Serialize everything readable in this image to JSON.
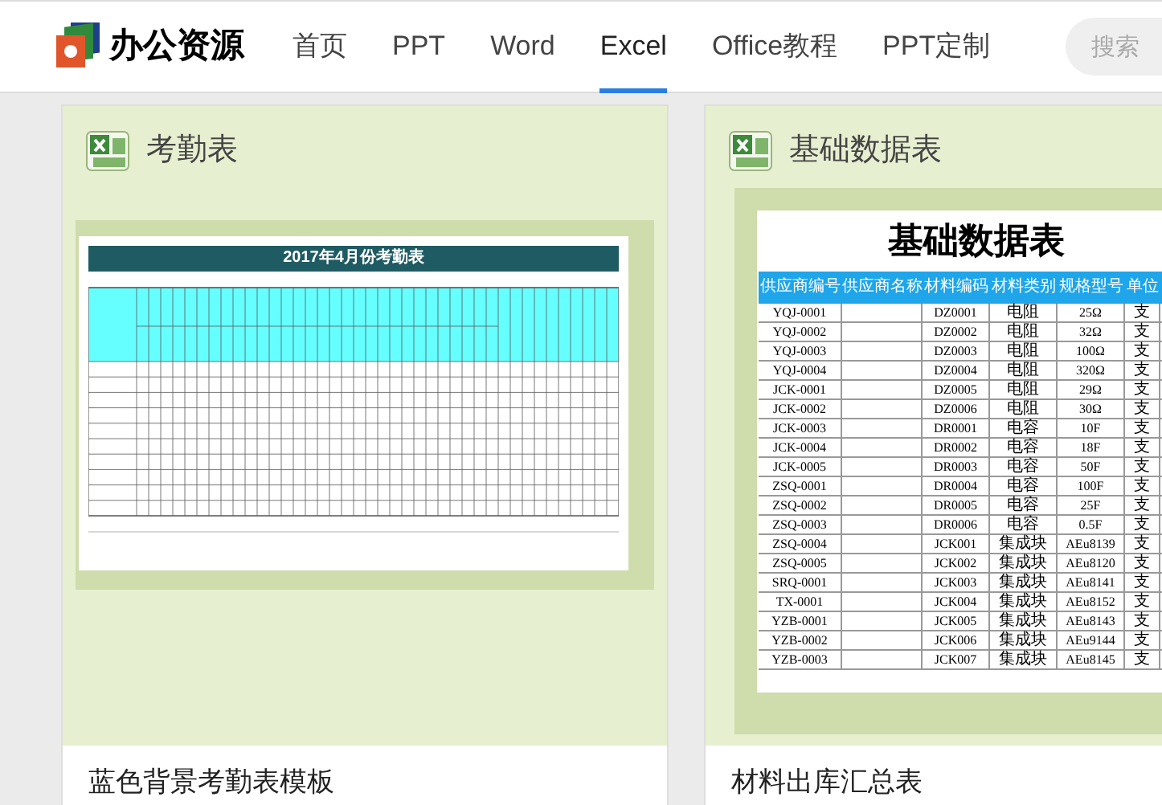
{
  "header": {
    "logo": "办公资源",
    "nav": [
      {
        "label": "首页",
        "selected": false
      },
      {
        "label": "PPT",
        "selected": false
      },
      {
        "label": "Word",
        "selected": false
      },
      {
        "label": "Excel",
        "selected": true
      },
      {
        "label": "Office教程",
        "selected": false
      },
      {
        "label": "PPT定制",
        "selected": false
      }
    ],
    "search": {
      "placeholder": "搜索"
    }
  },
  "cards": [
    {
      "kind": "attendance",
      "title": "考勤表",
      "sheet_title": "2017年4月份考勤表",
      "caption": "蓝色背景考勤表模板"
    },
    {
      "kind": "table",
      "title": "基础数据表",
      "sheet_title": "基础数据表",
      "columns": [
        "供应商编号",
        "供应商名称",
        "材料编码",
        "材料类别",
        "规格型号",
        "单位"
      ],
      "rows": [
        {
          "supplier_code": "YQJ-0001",
          "material_code": "DZ0001",
          "category": "电阻",
          "spec": "25Ω",
          "unit": "支"
        },
        {
          "supplier_code": "YQJ-0002",
          "material_code": "DZ0002",
          "category": "电阻",
          "spec": "32Ω",
          "unit": "支"
        },
        {
          "supplier_code": "YQJ-0003",
          "material_code": "DZ0003",
          "category": "电阻",
          "spec": "100Ω",
          "unit": "支"
        },
        {
          "supplier_code": "YQJ-0004",
          "material_code": "DZ0004",
          "category": "电阻",
          "spec": "320Ω",
          "unit": "支"
        },
        {
          "supplier_code": "JCK-0001",
          "material_code": "DZ0005",
          "category": "电阻",
          "spec": "29Ω",
          "unit": "支"
        },
        {
          "supplier_code": "JCK-0002",
          "material_code": "DZ0006",
          "category": "电阻",
          "spec": "30Ω",
          "unit": "支"
        },
        {
          "supplier_code": "JCK-0003",
          "material_code": "DR0001",
          "category": "电容",
          "spec": "10F",
          "unit": "支"
        },
        {
          "supplier_code": "JCK-0004",
          "material_code": "DR0002",
          "category": "电容",
          "spec": "18F",
          "unit": "支"
        },
        {
          "supplier_code": "JCK-0005",
          "material_code": "DR0003",
          "category": "电容",
          "spec": "50F",
          "unit": "支"
        },
        {
          "supplier_code": "ZSQ-0001",
          "material_code": "DR0004",
          "category": "电容",
          "spec": "100F",
          "unit": "支"
        },
        {
          "supplier_code": "ZSQ-0002",
          "material_code": "DR0005",
          "category": "电容",
          "spec": "25F",
          "unit": "支"
        },
        {
          "supplier_code": "ZSQ-0003",
          "material_code": "DR0006",
          "category": "电容",
          "spec": "0.5F",
          "unit": "支"
        },
        {
          "supplier_code": "ZSQ-0004",
          "material_code": "JCK001",
          "category": "集成块",
          "spec": "AEu8139",
          "unit": "支"
        },
        {
          "supplier_code": "ZSQ-0005",
          "material_code": "JCK002",
          "category": "集成块",
          "spec": "AEu8120",
          "unit": "支"
        },
        {
          "supplier_code": "SRQ-0001",
          "material_code": "JCK003",
          "category": "集成块",
          "spec": "AEu8141",
          "unit": "支"
        },
        {
          "supplier_code": "TX-0001",
          "material_code": "JCK004",
          "category": "集成块",
          "spec": "AEu8152",
          "unit": "支"
        },
        {
          "supplier_code": "YZB-0001",
          "material_code": "JCK005",
          "category": "集成块",
          "spec": "AEu8143",
          "unit": "支"
        },
        {
          "supplier_code": "YZB-0002",
          "material_code": "JCK006",
          "category": "集成块",
          "spec": "AEu9144",
          "unit": "支"
        },
        {
          "supplier_code": "YZB-0003",
          "material_code": "JCK007",
          "category": "集成块",
          "spec": "AEu8145",
          "unit": "支"
        }
      ],
      "caption": "材料出库汇总表"
    }
  ]
}
